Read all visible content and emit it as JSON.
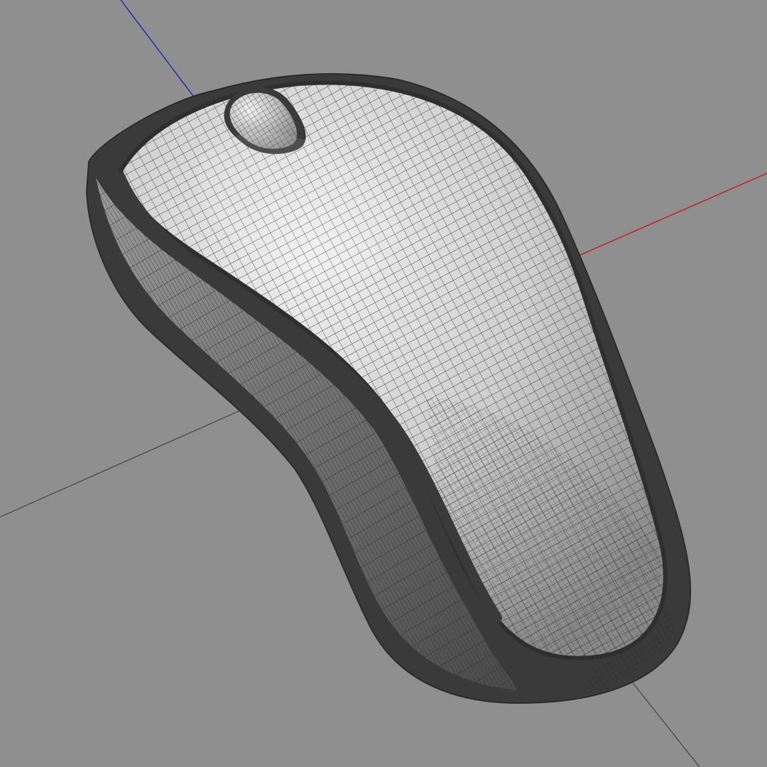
{
  "viewport": {
    "background": "#8f8f8f",
    "render_mode": "wireframe-on-shaded",
    "model": "computer-mouse",
    "parts": [
      "mouse-body",
      "mouse-top-shell",
      "scroll-wheel",
      "side-rim"
    ]
  },
  "axes": {
    "x": {
      "color": "#c41a1a"
    },
    "y": {
      "color": "#444444"
    },
    "z": {
      "color": "#2323b4"
    }
  },
  "colors": {
    "shell_light": "#dcdcdc",
    "shell_mid": "#a8a8a8",
    "shell_dark": "#6e6e6e",
    "rim": "#3a3a3a",
    "wire": "#2a2a2a"
  }
}
